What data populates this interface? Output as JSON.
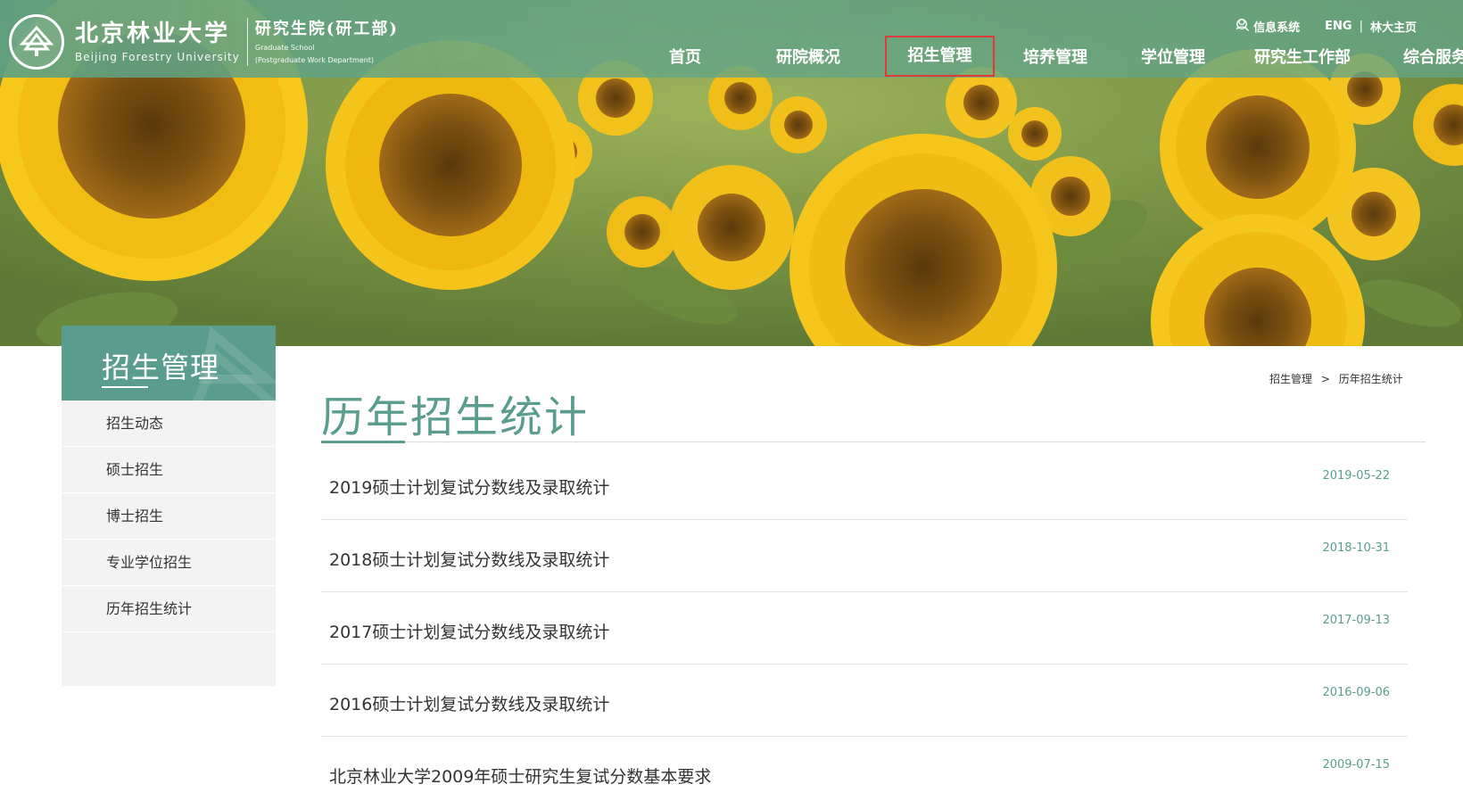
{
  "header": {
    "logo_cn": "北京林业大学",
    "logo_en": "Beijing Forestry University",
    "sub_cn": "研究生院(研工部)",
    "sub_en_1": "Graduate School",
    "sub_en_2": "(Postgraduate Work Department)",
    "util": {
      "info_system": "信息系统",
      "eng": "ENG",
      "separator": "|",
      "bjfu_home": "林大主页"
    },
    "nav": [
      {
        "label": "首页"
      },
      {
        "label": "研院概况"
      },
      {
        "label": "招生管理",
        "active": true
      },
      {
        "label": "培养管理"
      },
      {
        "label": "学位管理"
      },
      {
        "label": "研究生工作部"
      },
      {
        "label": "综合服务"
      }
    ]
  },
  "sidebar": {
    "title": "招生管理",
    "items": [
      {
        "label": "招生动态"
      },
      {
        "label": "硕士招生"
      },
      {
        "label": "博士招生"
      },
      {
        "label": "专业学位招生"
      },
      {
        "label": "历年招生统计"
      }
    ]
  },
  "breadcrumb": {
    "parent": "招生管理",
    "arrow": ">",
    "current": "历年招生统计"
  },
  "main": {
    "title": "历年招生统计",
    "articles": [
      {
        "title": "2019硕士计划复试分数线及录取统计",
        "date": "2019-05-22"
      },
      {
        "title": "2018硕士计划复试分数线及录取统计",
        "date": "2018-10-31"
      },
      {
        "title": "2017硕士计划复试分数线及录取统计",
        "date": "2017-09-13"
      },
      {
        "title": "2016硕士计划复试分数线及录取统计",
        "date": "2016-09-06"
      },
      {
        "title": "北京林业大学2009年硕士研究生复试分数基本要求",
        "date": "2009-07-15"
      }
    ]
  },
  "colors": {
    "accent": "#5a9d8e",
    "active_nav_border": "#e03a3a"
  }
}
